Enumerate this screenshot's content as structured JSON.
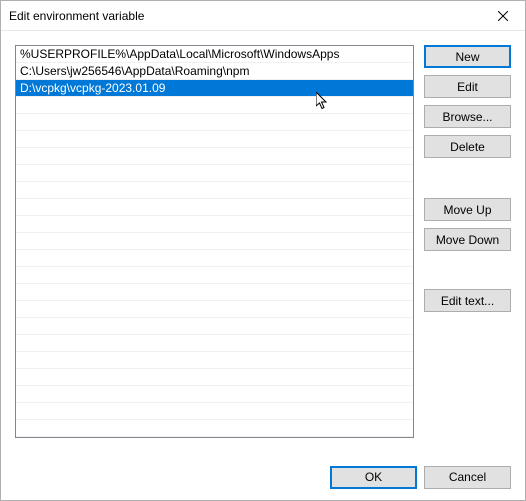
{
  "title": "Edit environment variable",
  "entries": [
    {
      "text": "%USERPROFILE%\\AppData\\Local\\Microsoft\\WindowsApps",
      "selected": false
    },
    {
      "text": "C:\\Users\\jw256546\\AppData\\Roaming\\npm",
      "selected": false
    },
    {
      "text": "D:\\vcpkg\\vcpkg-2023.01.09",
      "selected": true
    }
  ],
  "buttons": {
    "new": "New",
    "edit": "Edit",
    "browse": "Browse...",
    "delete": "Delete",
    "move_up": "Move Up",
    "move_down": "Move Down",
    "edit_text": "Edit text...",
    "ok": "OK",
    "cancel": "Cancel"
  },
  "blank_rows": 20
}
